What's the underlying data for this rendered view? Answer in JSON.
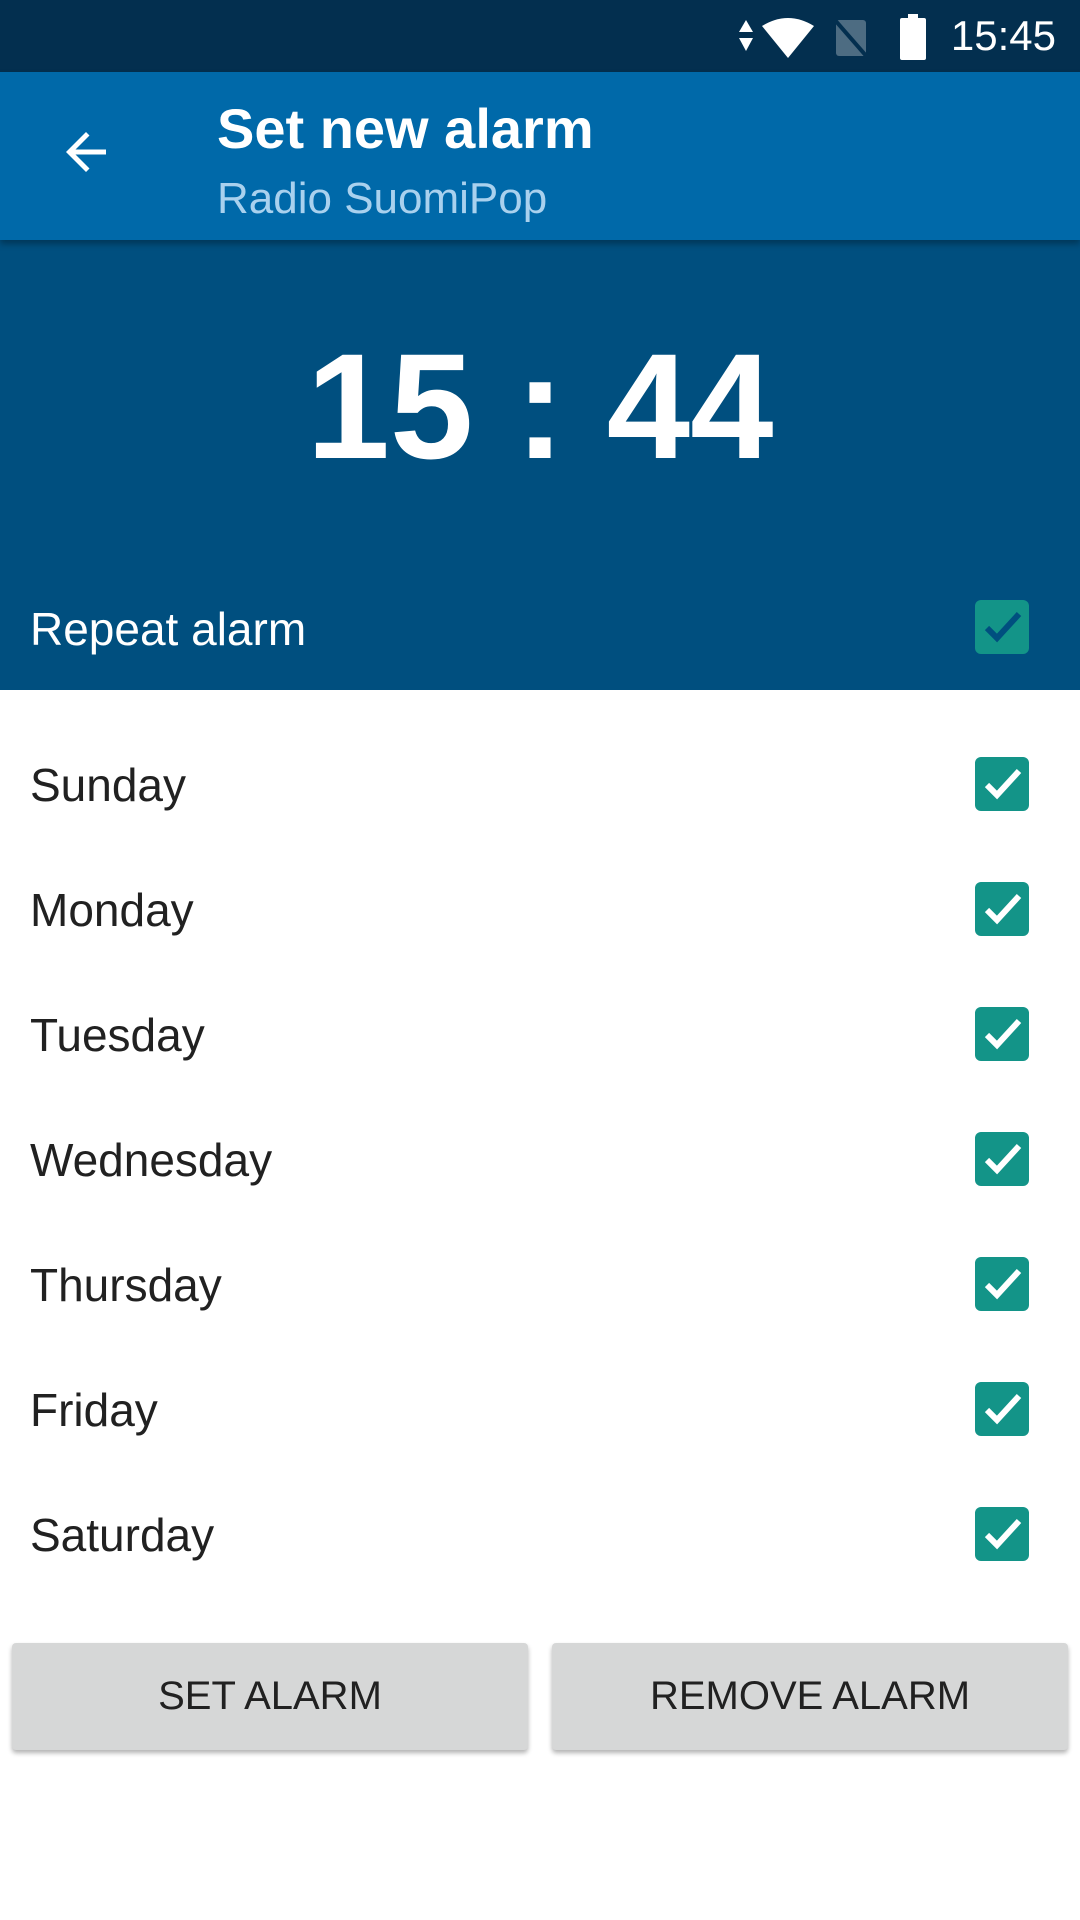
{
  "status_bar": {
    "time": "15:45",
    "icons": [
      "data-arrows-icon",
      "wifi-icon",
      "no-sim-icon",
      "battery-icon"
    ]
  },
  "app_bar": {
    "title": "Set new alarm",
    "subtitle": "Radio SuomiPop",
    "back_icon": "arrow-left-icon"
  },
  "alarm": {
    "time": "15 : 44",
    "repeat_label": "Repeat alarm",
    "repeat_checked": true
  },
  "days": [
    {
      "label": "Sunday",
      "checked": true
    },
    {
      "label": "Monday",
      "checked": true
    },
    {
      "label": "Tuesday",
      "checked": true
    },
    {
      "label": "Wednesday",
      "checked": true
    },
    {
      "label": "Thursday",
      "checked": true
    },
    {
      "label": "Friday",
      "checked": true
    },
    {
      "label": "Saturday",
      "checked": true
    }
  ],
  "buttons": {
    "set": "SET ALARM",
    "remove": "REMOVE ALARM"
  },
  "colors": {
    "status_bar": "#032f4f",
    "app_bar": "#0069a9",
    "hero": "#004f7f",
    "checkbox": "#139488"
  }
}
